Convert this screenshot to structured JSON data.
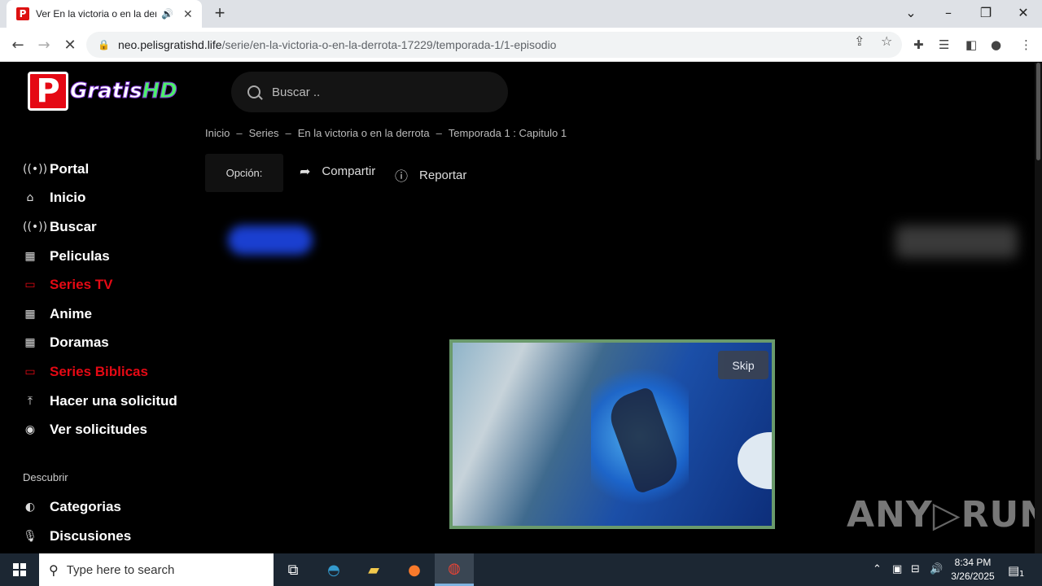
{
  "browser": {
    "tab_title": "Ver En la victoria o en la derrota",
    "url_host": "neo.pelisgratishd.life",
    "url_path": "/serie/en-la-victoria-o-en-la-derrota-17229/temporada-1/1-episodio"
  },
  "site": {
    "logo_letter": "P",
    "logo_text_a": "Gratis",
    "logo_text_b": "HD",
    "search_placeholder": "Buscar .."
  },
  "breadcrumb": [
    "Inicio",
    "Series",
    "En la victoria o en la derrota",
    "Temporada 1 : Capitulo 1"
  ],
  "breadcrumb_sep": "–",
  "actions": {
    "opcion": "Opción:",
    "compartir": "Compartir",
    "reportar": "Reportar"
  },
  "sidebar": {
    "items": [
      {
        "label": "Portal",
        "icon": "broadcast-icon",
        "active": false
      },
      {
        "label": "Inicio",
        "icon": "home-icon",
        "active": false
      },
      {
        "label": "Buscar",
        "icon": "broadcast-icon",
        "active": false
      },
      {
        "label": "Peliculas",
        "icon": "film-icon",
        "active": false
      },
      {
        "label": "Series TV",
        "icon": "tv-icon",
        "active": true
      },
      {
        "label": "Anime",
        "icon": "film-icon",
        "active": false
      },
      {
        "label": "Doramas",
        "icon": "film-icon",
        "active": false
      },
      {
        "label": "Series Biblicas",
        "icon": "tv-icon",
        "active": true
      },
      {
        "label": "Hacer una solicitud",
        "icon": "upload-icon",
        "active": false
      },
      {
        "label": "Ver solicitudes",
        "icon": "eye-icon",
        "active": false
      }
    ],
    "section_label": "Descubrir",
    "discover": [
      {
        "label": "Categorias",
        "icon": "half-circle-icon"
      },
      {
        "label": "Discusiones",
        "icon": "microphone-icon"
      }
    ]
  },
  "ad": {
    "skip_label": "Skip"
  },
  "watermark": {
    "a": "ANY",
    "b": "RUN"
  },
  "taskbar": {
    "search_placeholder": "Type here to search",
    "time": "8:34 PM",
    "date": "3/26/2025",
    "notification_count": "1"
  },
  "colors": {
    "accent_red": "#e50914",
    "background": "#000000"
  }
}
